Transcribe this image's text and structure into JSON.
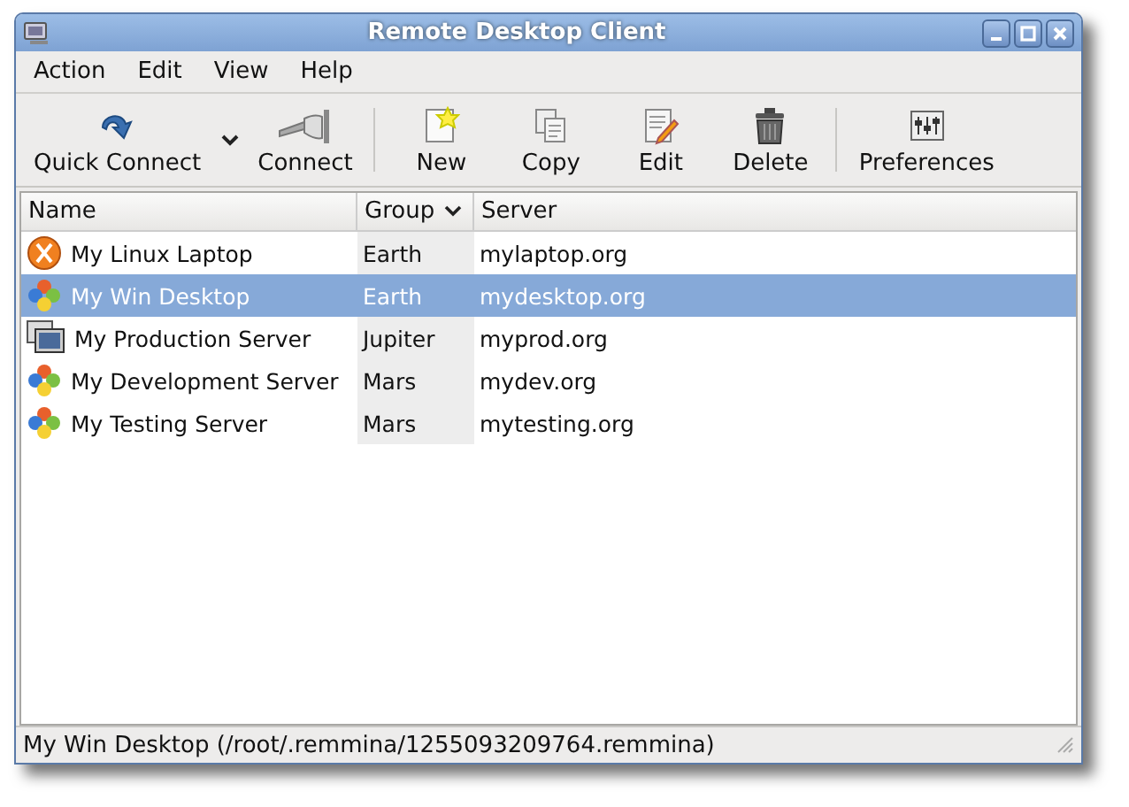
{
  "window": {
    "title": "Remote Desktop Client"
  },
  "menu": [
    "Action",
    "Edit",
    "View",
    "Help"
  ],
  "toolbar": [
    {
      "kind": "quick-connect",
      "label": "Quick Connect"
    },
    {
      "kind": "dropdown"
    },
    {
      "kind": "connect",
      "label": "Connect"
    },
    {
      "kind": "separator"
    },
    {
      "kind": "new",
      "label": "New"
    },
    {
      "kind": "copy",
      "label": "Copy"
    },
    {
      "kind": "edit",
      "label": "Edit"
    },
    {
      "kind": "delete",
      "label": "Delete"
    },
    {
      "kind": "separator"
    },
    {
      "kind": "preferences",
      "label": "Preferences"
    }
  ],
  "table": {
    "columns": [
      {
        "label": "Name",
        "sorted": false
      },
      {
        "label": "Group",
        "sorted": true
      },
      {
        "label": "Server",
        "sorted": false
      }
    ],
    "rows": [
      {
        "kind": "linux",
        "name": "My Linux Laptop",
        "group": "Earth",
        "server": "mylaptop.org",
        "selected": false
      },
      {
        "kind": "windows",
        "name": "My Win Desktop",
        "group": "Earth",
        "server": "mydesktop.org",
        "selected": true
      },
      {
        "kind": "monitor",
        "name": "My Production Server",
        "group": "Jupiter",
        "server": "myprod.org",
        "selected": false
      },
      {
        "kind": "windows",
        "name": "My Development Server",
        "group": "Mars",
        "server": "mydev.org",
        "selected": false
      },
      {
        "kind": "windows",
        "name": "My Testing Server",
        "group": "Mars",
        "server": "mytesting.org",
        "selected": false
      }
    ]
  },
  "status_bar": "My Win Desktop (/root/.remmina/1255093209764.remmina)"
}
